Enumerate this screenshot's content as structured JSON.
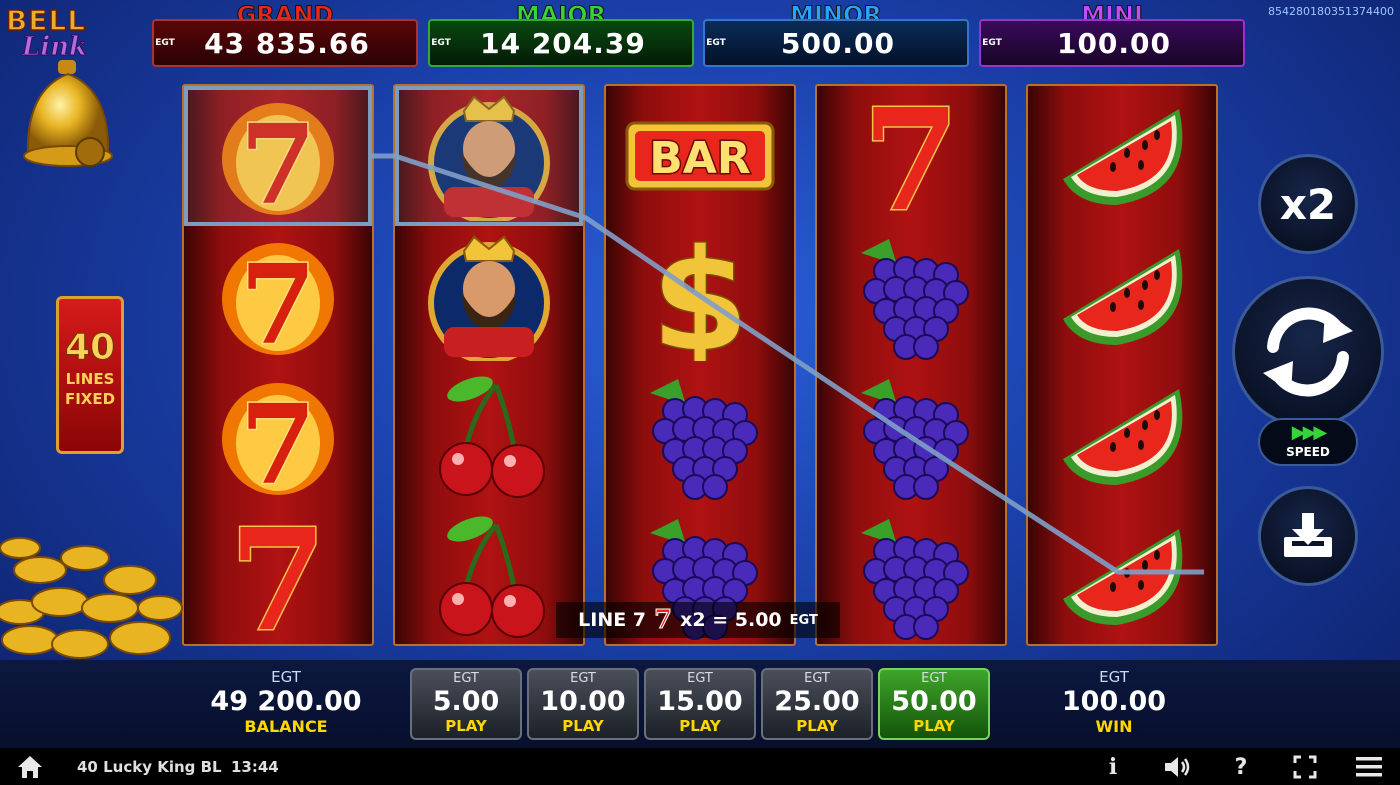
{
  "session_id": "854280180351374400",
  "logo": {
    "line1": "BELL",
    "line2": "Link"
  },
  "jackpots": [
    {
      "name": "GRAND",
      "currency": "EGT",
      "value": "43 835.66"
    },
    {
      "name": "MAJOR",
      "currency": "EGT",
      "value": "14 204.39"
    },
    {
      "name": "MINOR",
      "currency": "EGT",
      "value": "500.00"
    },
    {
      "name": "MINI",
      "currency": "EGT",
      "value": "100.00"
    }
  ],
  "lines_fixed": {
    "number": "40",
    "line1": "LINES",
    "line2": "FIXED"
  },
  "reels": [
    [
      "burning-seven",
      "burning-seven",
      "burning-seven",
      "seven"
    ],
    [
      "king",
      "king",
      "cherries",
      "cherries"
    ],
    [
      "bar",
      "dollar",
      "grapes",
      "grapes"
    ],
    [
      "seven",
      "grapes",
      "grapes",
      "grapes"
    ],
    [
      "watermelon",
      "watermelon",
      "watermelon",
      "watermelon"
    ]
  ],
  "bar_symbol_text": "BAR",
  "dollar_symbol_text": "$",
  "seven_symbol_text": "7",
  "win_line": {
    "line": "LINE 7",
    "symbol": "7",
    "multiplier": "x2 = 5.00",
    "currency": "EGT"
  },
  "controls": {
    "multiplier": "x2",
    "speed_label": "SPEED"
  },
  "balance": {
    "currency": "EGT",
    "value": "49 200.00",
    "label": "BALANCE"
  },
  "bets": [
    {
      "currency": "EGT",
      "value": "5.00",
      "label": "PLAY",
      "active": false
    },
    {
      "currency": "EGT",
      "value": "10.00",
      "label": "PLAY",
      "active": false
    },
    {
      "currency": "EGT",
      "value": "15.00",
      "label": "PLAY",
      "active": false
    },
    {
      "currency": "EGT",
      "value": "25.00",
      "label": "PLAY",
      "active": false
    },
    {
      "currency": "EGT",
      "value": "50.00",
      "label": "PLAY",
      "active": true
    }
  ],
  "win": {
    "currency": "EGT",
    "value": "100.00",
    "label": "WIN"
  },
  "footer": {
    "game_name": "40 Lucky King BL",
    "clock": "13:44"
  },
  "colors": {
    "grand": "#e8261c",
    "major": "#35d43a",
    "minor": "#2aa3ff",
    "mini": "#c64aff",
    "label_gold": "#ffd700",
    "reel_red": "#b01212"
  }
}
